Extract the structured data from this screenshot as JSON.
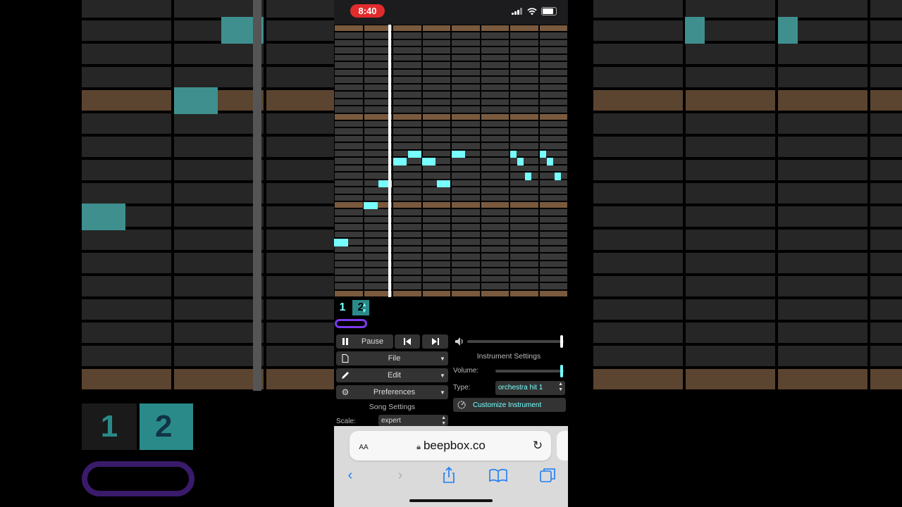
{
  "status_bar": {
    "time": "8:40"
  },
  "patterns": {
    "pattern_1": "1",
    "pattern_2": "2",
    "arrows_up": "▲",
    "arrows_down": "▼"
  },
  "playback": {
    "pause_label": "Pause",
    "prev_icon": "skip-back-icon",
    "next_icon": "skip-forward-icon"
  },
  "menus": {
    "file_label": "File",
    "edit_label": "Edit",
    "preferences_label": "Preferences"
  },
  "song_settings": {
    "heading": "Song Settings",
    "scale_label": "Scale:",
    "scale_value": "expert"
  },
  "instrument_settings": {
    "heading": "Instrument Settings",
    "volume_label": "Volume:",
    "volume_level": 0.97,
    "type_label": "Type:",
    "type_value": "orchestra hit 1",
    "customize_label": "Customize Instrument"
  },
  "master_volume_level": 0.98,
  "browser": {
    "aa_label": "AA",
    "url": "beepbox.co"
  },
  "colors": {
    "note": "#77ffff",
    "octave_row": "#7a5a3e",
    "grid_cell": "#393939",
    "loop_outline": "#7c3aed",
    "time_pill": "#e02c2c"
  }
}
